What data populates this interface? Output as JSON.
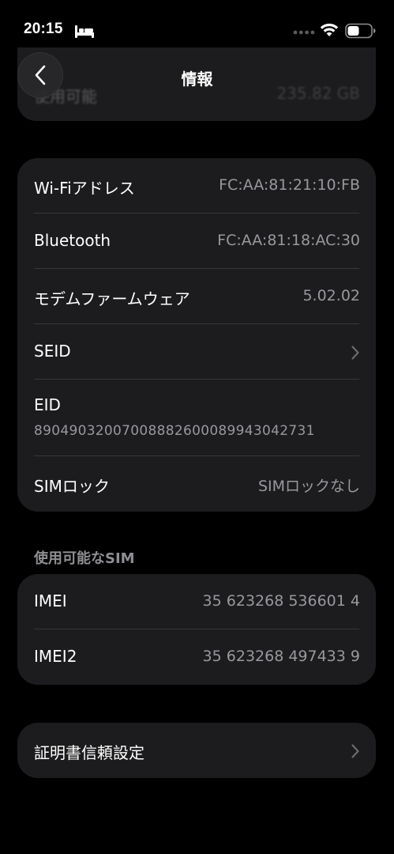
{
  "status_bar": {
    "time": "20:15"
  },
  "nav": {
    "title": "情報"
  },
  "top_card": {
    "label": "使用可能",
    "value": "235.82 GB"
  },
  "network_group": {
    "rows": [
      {
        "label": "Wi-Fiアドレス",
        "value": "FC:AA:81:21:10:FB"
      },
      {
        "label": "Bluetooth",
        "value": "FC:AA:81:18:AC:30"
      },
      {
        "label": "モデムファームウェア",
        "value": "5.02.02"
      },
      {
        "label": "SEID"
      },
      {
        "label": "EID",
        "value": "89049032007008882600089943042731"
      },
      {
        "label": "SIMロック",
        "value": "SIMロックなし"
      }
    ]
  },
  "sim_section": {
    "header": "使用可能なSIM",
    "rows": [
      {
        "label": "IMEI",
        "value": "35 623268 536601 4"
      },
      {
        "label": "IMEI2",
        "value": "35 623268 497433 9"
      }
    ]
  },
  "cert_group": {
    "label": "証明書信頼設定"
  },
  "colors": {
    "background": "#000000",
    "card": "#1c1c1e",
    "separator": "#38383a",
    "secondary_text": "#98989e"
  }
}
